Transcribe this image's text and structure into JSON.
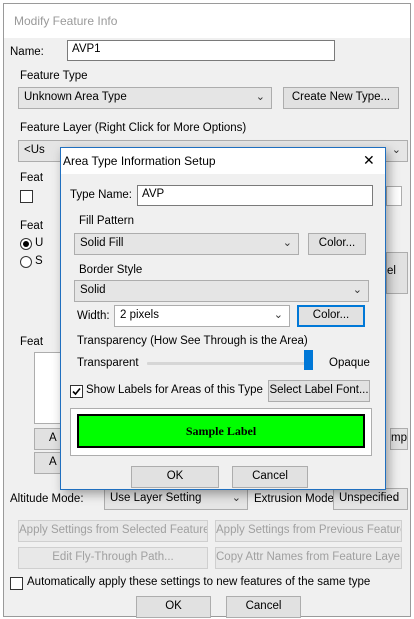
{
  "window": {
    "title": "Modify Feature Info",
    "name_label": "Name:",
    "name_value": "AVP1",
    "feature_type_label": "Feature Type",
    "feature_type_value": "Unknown Area Type",
    "create_new_type_label": "Create New Type...",
    "feature_layer_label": "Feature Layer (Right Click for More Options)",
    "feature_layer_value": "<Us",
    "feat_label_1": "Feat",
    "feat_label_2": "Feat",
    "feat_label_3": "Feat",
    "radio_1_label": "U",
    "radio_2_label": "S",
    "el_fragment": "el",
    "left_btn_1": "A",
    "left_btn_2": "A",
    "mp_fragment": "mp",
    "altitude_mode_label": "Altitude Mode:",
    "altitude_mode_value": "Use Layer Setting",
    "extrusion_mode_label": "Extrusion Mode:",
    "extrusion_mode_value": "Unspecified",
    "apply_selected_label": "Apply Settings from Selected Feature",
    "apply_previous_label": "Apply Settings from Previous Feature",
    "edit_flythrough_label": "Edit Fly-Through Path...",
    "copy_attr_label": "Copy Attr Names from Feature Layer",
    "auto_apply_label": "Automatically apply these settings to new features of the same type",
    "ok_label": "OK",
    "cancel_label": "Cancel"
  },
  "dialog": {
    "title": "Area Type Information Setup",
    "close_glyph": "✕",
    "type_name_label": "Type Name:",
    "type_name_value": "AVP",
    "fill_pattern_label": "Fill Pattern",
    "fill_pattern_value": "Solid Fill",
    "fill_color_label": "Color...",
    "border_style_label": "Border Style",
    "border_style_value": "Solid",
    "width_label": "Width:",
    "width_value": "2 pixels",
    "border_color_label": "Color...",
    "transparency_label": "Transparency (How See Through is the Area)",
    "transparent_label": "Transparent",
    "opaque_label": "Opaque",
    "transparency_value": 1.0,
    "show_labels_label": "Show Labels for Areas of this Type",
    "show_labels_checked": true,
    "select_label_font_label": "Select Label Font...",
    "sample_label": "Sample Label",
    "sample_fill_color": "#00ff00",
    "ok_label": "OK",
    "cancel_label": "Cancel"
  }
}
